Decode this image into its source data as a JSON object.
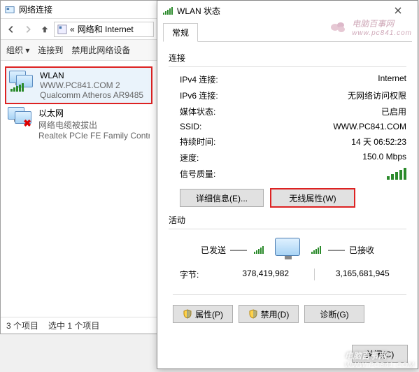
{
  "back": {
    "title": "网络连接",
    "breadcrumb_prefix": "«",
    "breadcrumb": "网络和 Internet",
    "toolbar": {
      "org": "组织 ▾",
      "conn": "连接到",
      "disable": "禁用此网络设备"
    },
    "items": [
      {
        "name": "WLAN",
        "line2": "WWW.PC841.COM  2",
        "line3": "Qualcomm Atheros AR9485",
        "selected": true,
        "signal": true
      },
      {
        "name": "以太网",
        "line2": "网络电缆被拔出",
        "line3": "Realtek PCIe FE Family Contr",
        "selected": false,
        "error": true
      }
    ],
    "status": {
      "count": "3 个项目",
      "sel": "选中 1 个项目"
    }
  },
  "front": {
    "title": "WLAN 状态",
    "tab": "常规",
    "watermark": {
      "zh": "电脑百事网",
      "url": "www.pc841.com"
    },
    "group_conn": "连接",
    "rows": {
      "ipv4_k": "IPv4 连接:",
      "ipv4_v": "Internet",
      "ipv6_k": "IPv6 连接:",
      "ipv6_v": "无网络访问权限",
      "media_k": "媒体状态:",
      "media_v": "已启用",
      "ssid_k": "SSID:",
      "ssid_v": "WWW.PC841.COM",
      "dur_k": "持续时间:",
      "dur_v": "14 天 06:52:23",
      "speed_k": "速度:",
      "speed_v": "150.0 Mbps",
      "sig_k": "信号质量:"
    },
    "buttons": {
      "details": "详细信息(E)...",
      "wprops": "无线属性(W)"
    },
    "group_act": "活动",
    "activity": {
      "sent": "已发送",
      "recv": "已接收",
      "dash": "——"
    },
    "bytes": {
      "label": "字节:",
      "sent": "378,419,982",
      "recv": "3,165,681,945"
    },
    "foot": {
      "props": "属性(P)",
      "disable": "禁用(D)",
      "diag": "诊断(G)"
    },
    "close": "关闭(C)"
  },
  "btm_watermark": {
    "text": "电脑百事网",
    "sub": "WWW.PC841.COM"
  }
}
